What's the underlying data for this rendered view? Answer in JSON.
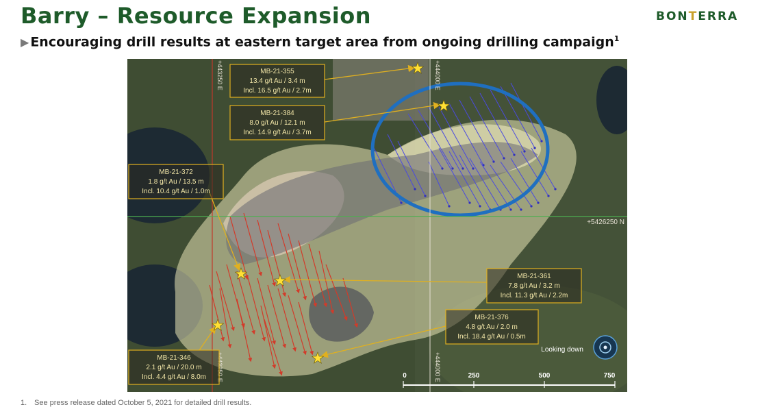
{
  "header": {
    "title": "Barry – Resource Expansion",
    "subtitle": "Encouraging drill results at eastern target area from ongoing drilling campaign",
    "subtitle_ref": "1",
    "logo_left": "BON",
    "logo_t": "T",
    "logo_right": "ERRA"
  },
  "map": {
    "gridlines": {
      "east1": "+443250 E",
      "east2": "+444000 E",
      "east1_bottom": "+443250 E",
      "east2_bottom": "+444000 E",
      "north": "+5426250 N"
    },
    "callouts": [
      {
        "id": "MB-21-355",
        "line1": "13.4 g/t Au / 3.4 m",
        "line2": "Incl. 16.5 g/t Au / 2.7m"
      },
      {
        "id": "MB-21-384",
        "line1": "8.0 g/t Au / 12.1 m",
        "line2": "Incl. 14.9 g/t Au / 3.7m"
      },
      {
        "id": "MB-21-372",
        "line1": "1.8 g/t Au / 13.5 m",
        "line2": "Incl. 10.4 g/t Au / 1.0m"
      },
      {
        "id": "MB-21-361",
        "line1": "7.8 g/t Au / 3.2 m",
        "line2": "Incl. 11.3 g/t Au / 2.2m"
      },
      {
        "id": "MB-21-376",
        "line1": "4.8 g/t Au / 2.0 m",
        "line2": "Incl. 18.4 g/t Au / 0.5m"
      },
      {
        "id": "MB-21-346",
        "line1": "2.1 g/t Au / 20.0 m",
        "line2": "Incl. 4.4 g/t Au / 8.0m"
      }
    ],
    "scale_bar": {
      "ticks": [
        "0",
        "250",
        "500",
        "750"
      ]
    },
    "view_label": "Looking down"
  },
  "footnote": {
    "number": "1.",
    "text": "See press release dated October 5, 2021 for detailed drill results."
  },
  "colors": {
    "title_green": "#1e5b2a",
    "logo_gold": "#c8a02a",
    "callout_border": "#e0b020",
    "target_ellipse": "#1f6fc0",
    "drill_red": "#d23b2a",
    "drill_blue": "#4a4adf"
  }
}
